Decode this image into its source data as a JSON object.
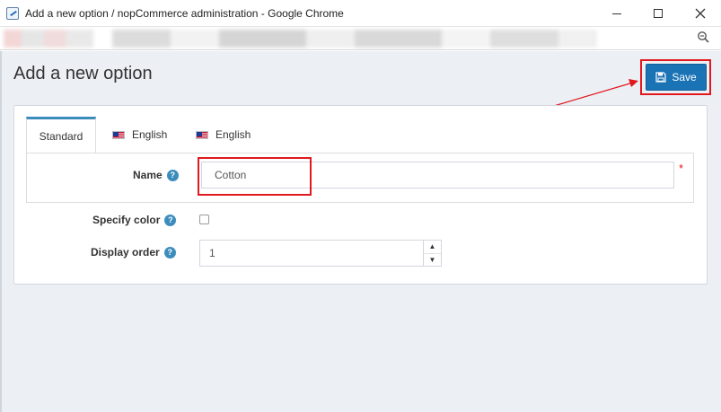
{
  "window": {
    "title": "Add a new option / nopCommerce administration - Google Chrome"
  },
  "icons": {
    "app": "nopcommerce-icon",
    "minimize": "minimize-icon",
    "maximize": "maximize-icon",
    "close": "close-icon",
    "zoom": "zoom-icon",
    "save": "floppy-disk-icon",
    "help": "question-circle-icon",
    "flag": "us-flag-icon"
  },
  "page": {
    "title": "Add a new option",
    "save_label": "Save"
  },
  "tabs": [
    {
      "label": "Standard",
      "active": true
    },
    {
      "label": "English",
      "active": false
    },
    {
      "label": "English",
      "active": false
    }
  ],
  "form": {
    "name_label": "Name",
    "name_value": "Cotton",
    "required_mark": "*",
    "help_glyph": "?",
    "specify_color_label": "Specify color",
    "specify_color_checked": false,
    "display_order_label": "Display order",
    "display_order_value": "1",
    "stepper_up": "▲",
    "stepper_down": "▼"
  },
  "colors": {
    "primary": "#1a73b5",
    "annotation": "#e0191f",
    "background": "#ecf0f5",
    "help": "#3c8dbc"
  }
}
